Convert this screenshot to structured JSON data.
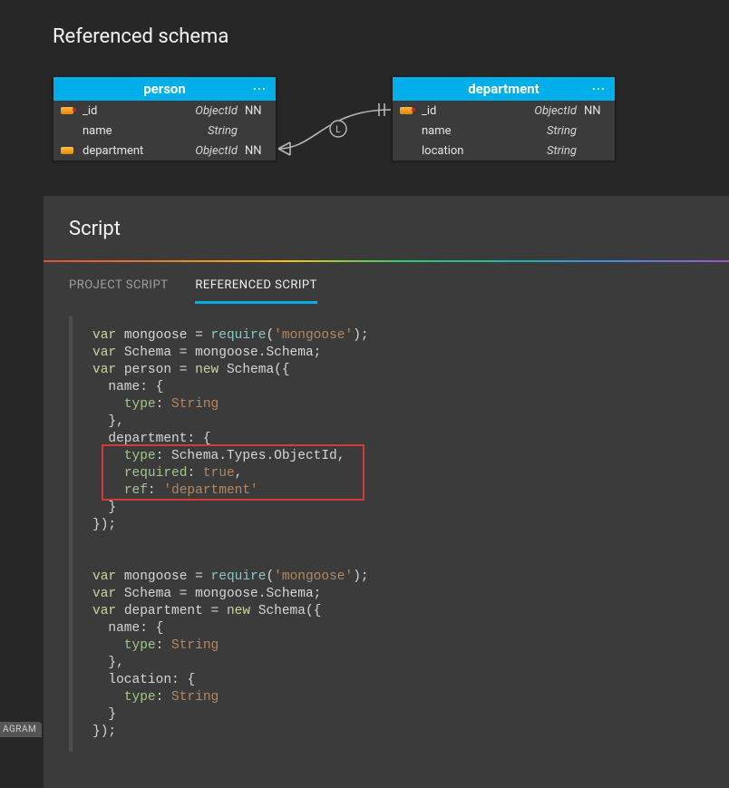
{
  "page_title": "Referenced schema",
  "entities": {
    "person": {
      "title": "person",
      "rows": [
        {
          "key": "pk",
          "name": "_id",
          "type": "ObjectId",
          "null": "NN"
        },
        {
          "key": "",
          "name": "name",
          "type": "String",
          "null": ""
        },
        {
          "key": "fk",
          "name": "department",
          "type": "ObjectId",
          "null": "NN"
        }
      ]
    },
    "department": {
      "title": "department",
      "rows": [
        {
          "key": "pk",
          "name": "_id",
          "type": "ObjectId",
          "null": "NN"
        },
        {
          "key": "",
          "name": "name",
          "type": "String",
          "null": ""
        },
        {
          "key": "",
          "name": "location",
          "type": "String",
          "null": ""
        }
      ]
    }
  },
  "relationship_glyph": "L",
  "ellipsis": "...",
  "script_panel": {
    "title": "Script",
    "tabs": {
      "project": "PROJECT SCRIPT",
      "referenced": "REFERENCED SCRIPT"
    },
    "active_tab": "referenced"
  },
  "code_tokens": {
    "var": "var",
    "new": "new",
    "require": "require",
    "mongoose_str": "'mongoose'",
    "String": "String",
    "true": "true",
    "department_str": "'department'",
    "mongoose": "mongoose",
    "Schema": "Schema",
    "SchemaSchema": "mongoose.Schema",
    "person": "person",
    "department": "department",
    "name": "name",
    "location": "location",
    "type": "type",
    "required": "required",
    "ref": "ref",
    "SchemaTypesObjectId": "Schema.Types.ObjectId",
    "NewSchemaOpen": "Schema({",
    "close": "});",
    "braceOpen": "{",
    "braceClose": "}",
    "braceCloseComma": "},",
    "eq": " = ",
    "semi": ";",
    "colon": ": ",
    "comma": ","
  },
  "partial_tab": "AGRAM"
}
